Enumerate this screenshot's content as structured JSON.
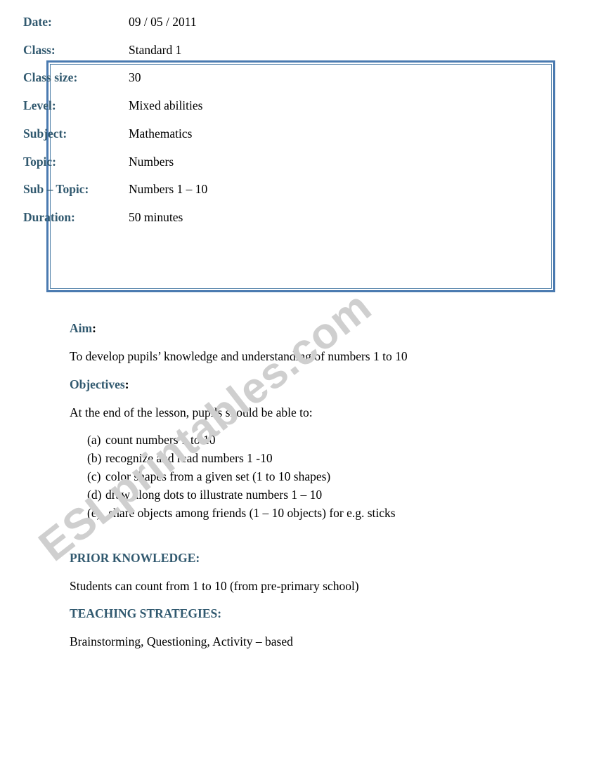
{
  "document": {
    "watermark": "ESLprintables.com",
    "colors": {
      "heading_blue": "#31596f",
      "border_blue": "#4a7ab0",
      "watermark_gray": "#cfcfcf",
      "body_black": "#000000"
    },
    "info_box": {
      "rows": [
        {
          "label": "Date:",
          "value": "09 / 05 / 2011"
        },
        {
          "label": "Class:",
          "value": "Standard 1"
        },
        {
          "label": "Class size:",
          "value": "30"
        },
        {
          "label": "Level:",
          "value": "Mixed abilities"
        },
        {
          "label": "Subject:",
          "value": "Mathematics"
        },
        {
          "label": "Topic:",
          "value": "Numbers"
        },
        {
          "label": "Sub – Topic:",
          "value": "Numbers 1 – 10"
        },
        {
          "label": "Duration:",
          "value": "50 minutes"
        }
      ]
    },
    "sections": {
      "aim": {
        "heading": "Aim",
        "heading_punct": ":",
        "text": "To develop pupils’ knowledge and understanding of numbers 1 to 10"
      },
      "objectives": {
        "heading": "Objectives",
        "heading_punct": ":",
        "intro": "At the end of the lesson, pupils should be able to:",
        "items": [
          {
            "marker": "(a)",
            "text": "count numbers 1 to 10"
          },
          {
            "marker": "(b)",
            "text": "recognize and read numbers 1 -10"
          },
          {
            "marker": "(c)",
            "text": "color shapes from a given set (1 to 10 shapes)"
          },
          {
            "marker": "(d)",
            "text": "draw along dots to illustrate numbers 1 – 10"
          },
          {
            "marker": "(e)",
            "text": " share objects among friends (1 – 10 objects) for e.g. sticks"
          }
        ]
      },
      "prior_knowledge": {
        "heading": "PRIOR KNOWLEDGE:",
        "text": "Students can count from 1 to 10 (from pre-primary school)"
      },
      "teaching_strategies": {
        "heading": "TEACHING STRATEGIES:",
        "text": "Brainstorming, Questioning, Activity – based"
      }
    }
  }
}
